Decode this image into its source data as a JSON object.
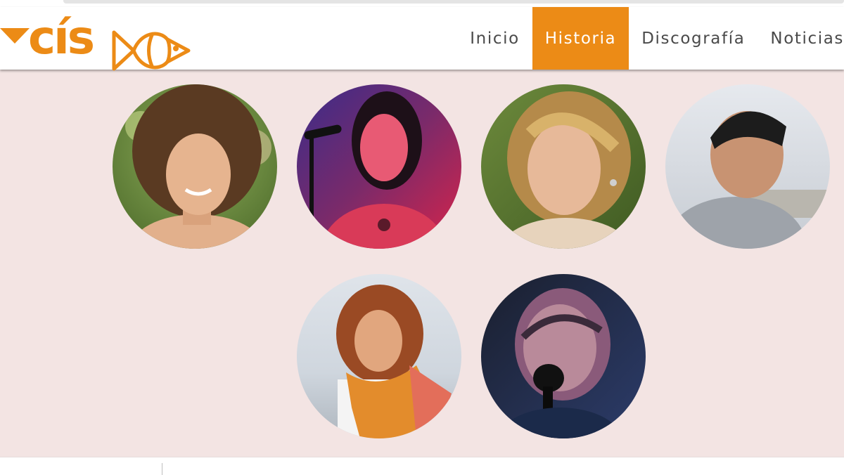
{
  "logo": {
    "text": "cís",
    "brand_color": "#ec8b16",
    "icons": [
      "triangle-mark-icon",
      "fish-outline-icon"
    ]
  },
  "nav": {
    "items": [
      "Inicio",
      "Historia",
      "Discografía",
      "Noticias"
    ],
    "active": "Historia",
    "active_color": "#ec8b16"
  },
  "members": {
    "photo_count": 6,
    "background_color": "#f3e4e3"
  }
}
